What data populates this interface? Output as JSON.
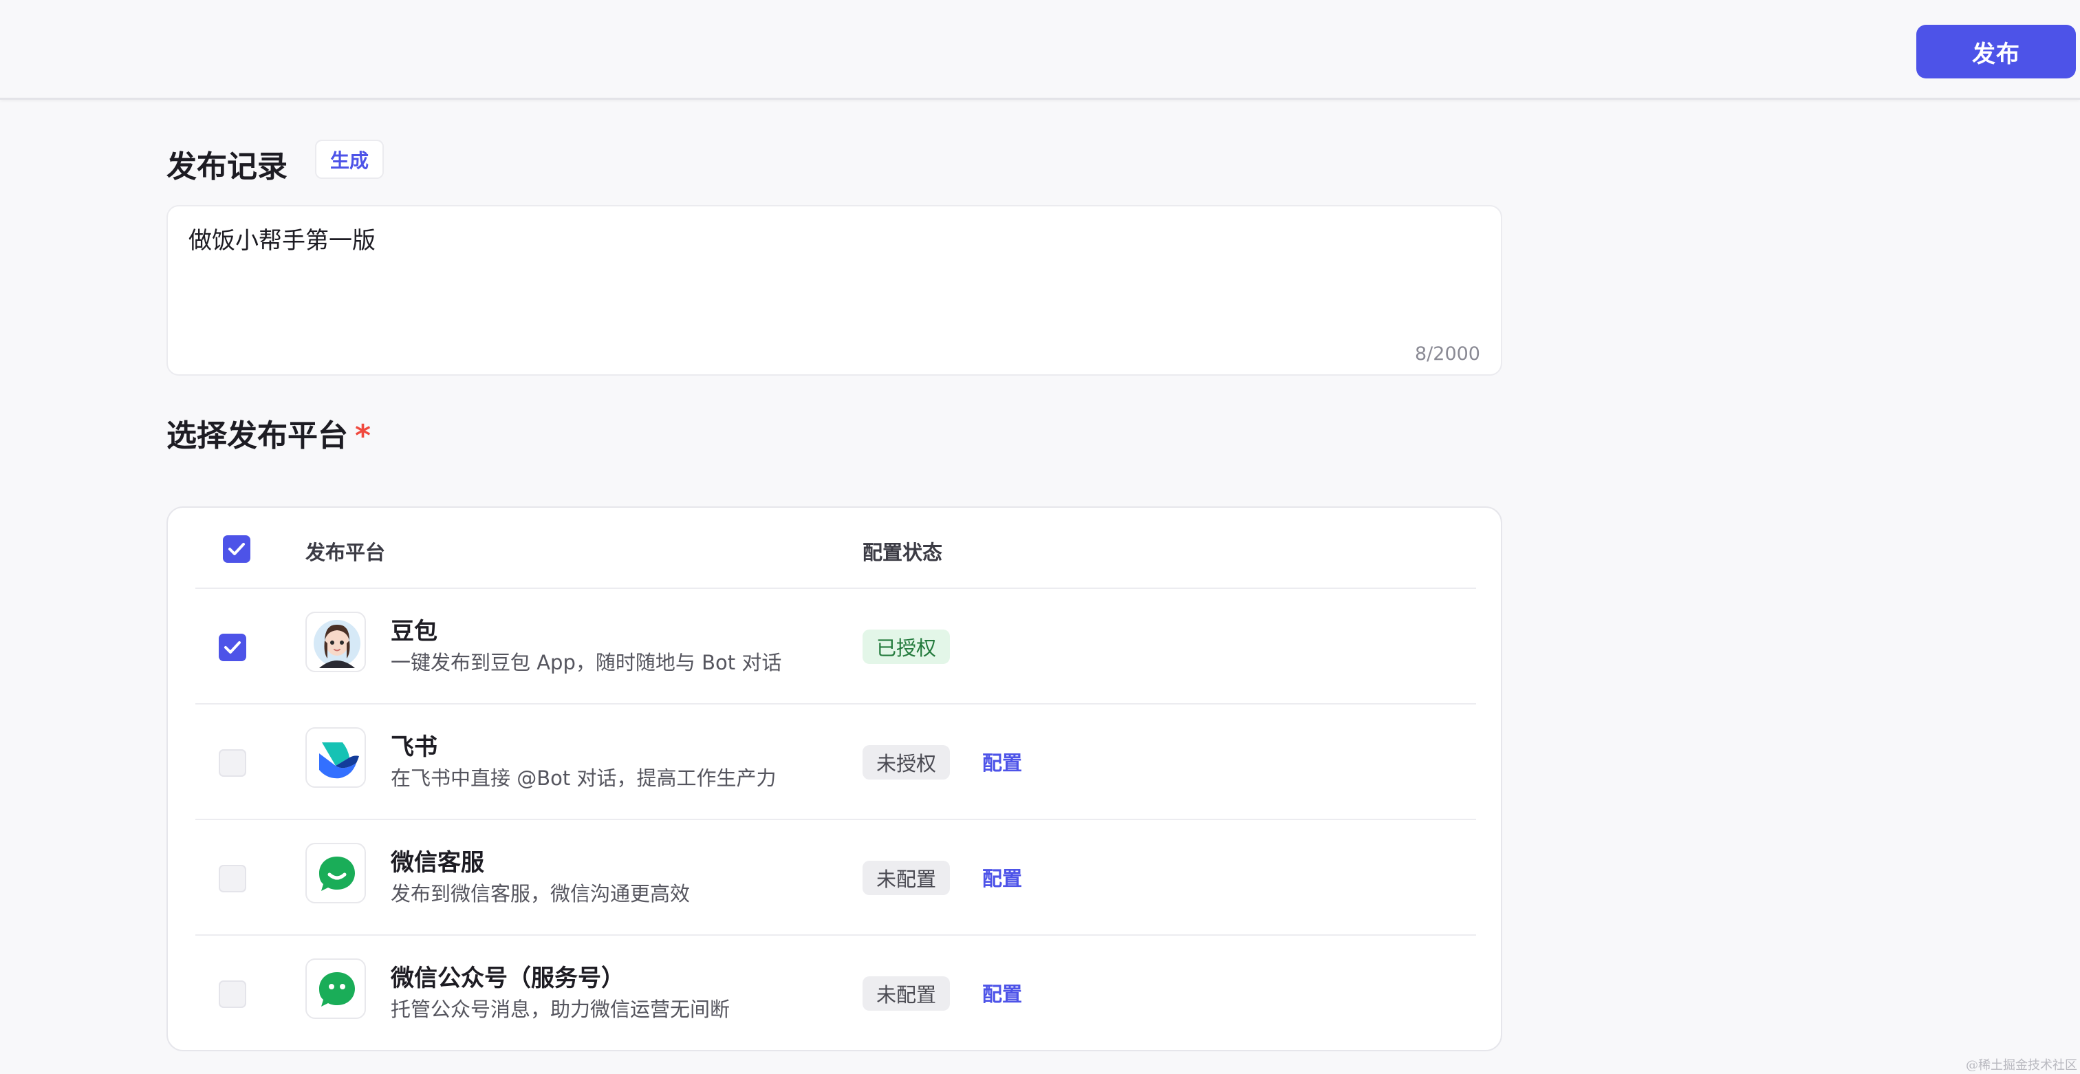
{
  "topbar": {
    "publish_label": "发布"
  },
  "record": {
    "title": "发布记录",
    "generate_label": "生成",
    "value": "做饭小帮手第一版",
    "count": "8/2000"
  },
  "platform": {
    "title": "选择发布平台",
    "required_mark": "*",
    "header": {
      "platform_label": "发布平台",
      "status_label": "配置状态",
      "all_checked": true
    },
    "items": [
      {
        "name": "豆包",
        "desc": "一键发布到豆包 App，随时随地与 Bot 对话",
        "status": "已授权",
        "status_type": "ok",
        "checked": true,
        "config_label": "",
        "icon": "doubao-avatar-icon"
      },
      {
        "name": "飞书",
        "desc": "在飞书中直接 @Bot 对话，提高工作生产力",
        "status": "未授权",
        "status_type": "no",
        "checked": false,
        "config_label": "配置",
        "icon": "feishu-icon"
      },
      {
        "name": "微信客服",
        "desc": "发布到微信客服，微信沟通更高效",
        "status": "未配置",
        "status_type": "no",
        "checked": false,
        "config_label": "配置",
        "icon": "wechat-service-icon"
      },
      {
        "name": "微信公众号（服务号）",
        "desc": "托管公众号消息，助力微信运营无间断",
        "status": "未配置",
        "status_type": "no",
        "checked": false,
        "config_label": "配置",
        "icon": "wechat-official-icon"
      }
    ]
  },
  "watermark": "@稀土掘金技术社区",
  "colors": {
    "accent": "#4d53e8",
    "success_bg": "#e3f6e8",
    "success_text": "#237a3c",
    "required": "#f0493e"
  }
}
